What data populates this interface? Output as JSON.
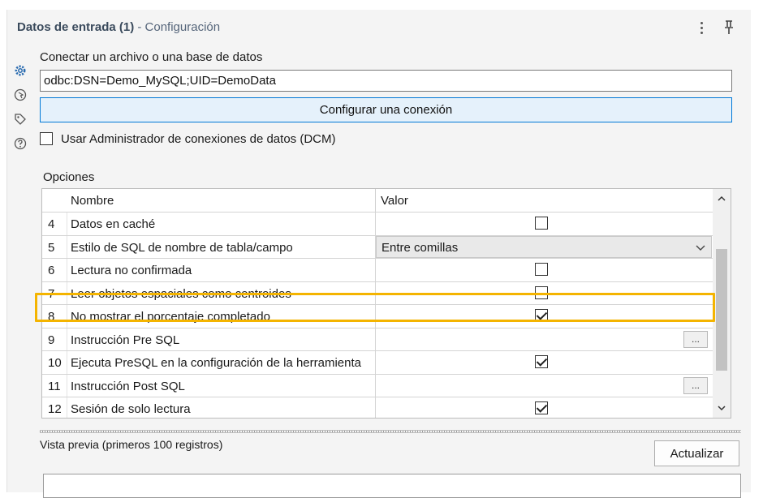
{
  "window": {
    "title": "Datos de entrada (1)",
    "subtitle": " - Configuración"
  },
  "sidebar": {
    "icons": [
      "gear-icon",
      "globe-cursor-icon",
      "tag-icon",
      "help-icon"
    ]
  },
  "connection": {
    "label": "Conectar un archivo o una base de datos",
    "value": "odbc:DSN=Demo_MySQL;UID=DemoData",
    "configure_button": "Configurar una conexión",
    "dcm_label": "Usar Administrador de conexiones de datos (DCM)",
    "dcm_checked": false
  },
  "options": {
    "label": "Opciones",
    "columns": {
      "name": "Nombre",
      "value": "Valor"
    },
    "rows": [
      {
        "num": "4",
        "name": "Datos en caché",
        "type": "checkbox",
        "checked": false
      },
      {
        "num": "5",
        "name": "Estilo de SQL de nombre de tabla/campo",
        "type": "dropdown",
        "value": "Entre comillas"
      },
      {
        "num": "6",
        "name": "Lectura no confirmada",
        "type": "checkbox",
        "checked": false
      },
      {
        "num": "7",
        "name": "Leer objetos espaciales como centroides",
        "type": "checkbox",
        "checked": false
      },
      {
        "num": "8",
        "name": "No mostrar el porcentaje completado",
        "type": "checkbox",
        "checked": true,
        "highlighted": true
      },
      {
        "num": "9",
        "name": "Instrucción Pre SQL",
        "type": "ellipsis",
        "value": "..."
      },
      {
        "num": "10",
        "name": "Ejecuta PreSQL en la configuración de la herramienta",
        "type": "checkbox",
        "checked": true
      },
      {
        "num": "11",
        "name": "Instrucción Post SQL",
        "type": "ellipsis",
        "value": "..."
      },
      {
        "num": "12",
        "name": "Sesión de solo lectura",
        "type": "checkbox",
        "checked": true
      }
    ]
  },
  "preview": {
    "label": "Vista previa (primeros 100 registros)",
    "refresh_button": "Actualizar"
  },
  "colors": {
    "highlight": "#f4b400",
    "button_accent": "#0078d7",
    "button_fill": "#e5f1fb"
  }
}
